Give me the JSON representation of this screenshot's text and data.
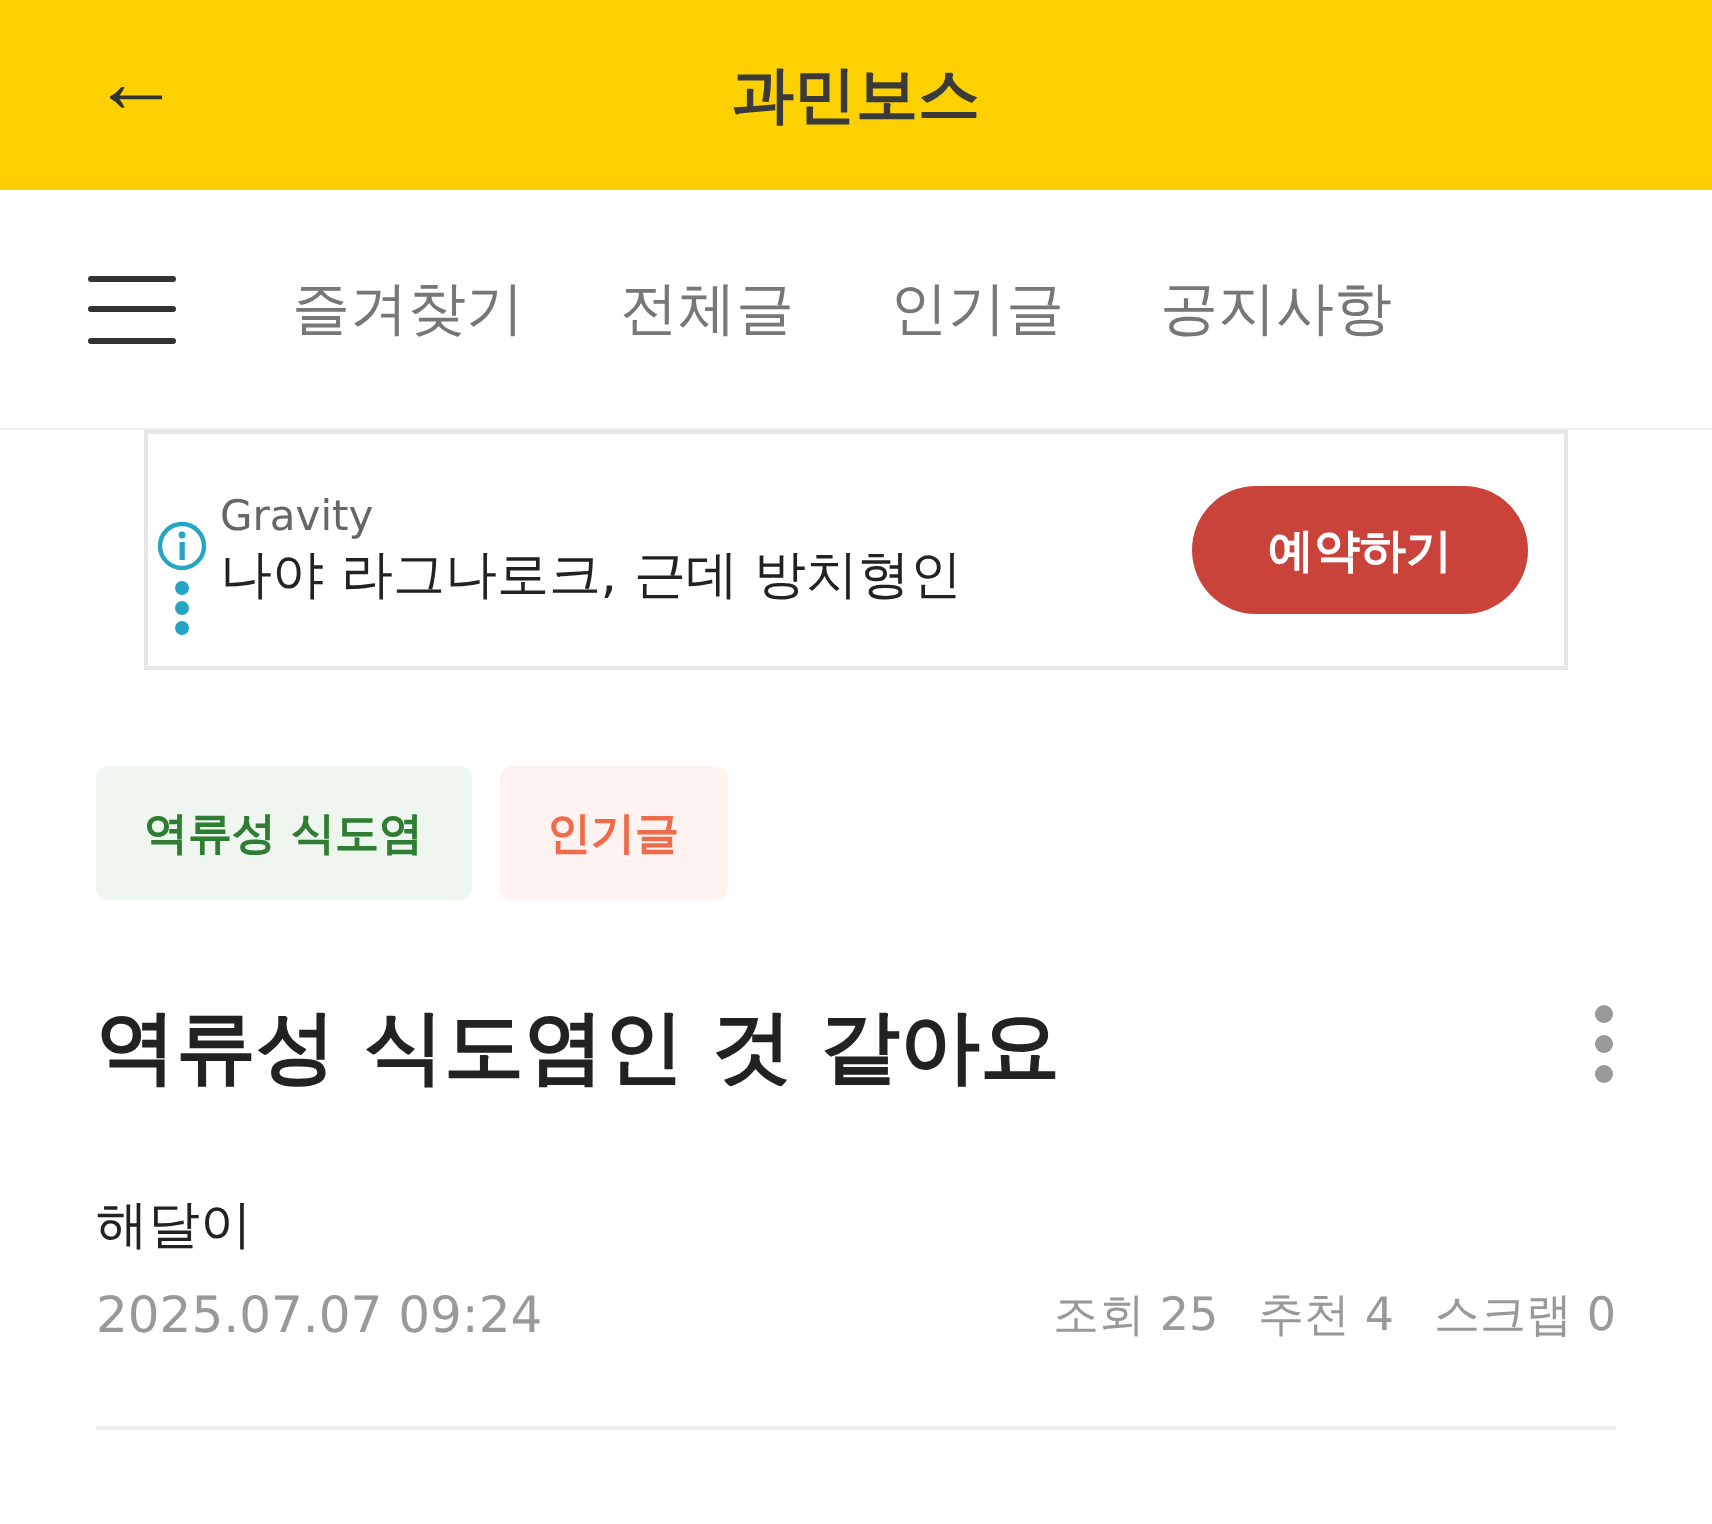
{
  "header": {
    "back": "←",
    "title": "과민보스"
  },
  "nav": {
    "tabs": [
      {
        "label": "즐겨찾기",
        "selected": false
      },
      {
        "label": "전체글",
        "selected": false
      },
      {
        "label": "인기글",
        "selected": false
      },
      {
        "label": "공지사항",
        "selected": false
      }
    ]
  },
  "ad": {
    "advertiser": "Gravity",
    "headline": "나야 라그나로크, 근데 방치형인",
    "button": "예약하기"
  },
  "post": {
    "tags": [
      {
        "label": "역류성 식도염",
        "color": "#2e7d32"
      },
      {
        "label": "인기글",
        "color": "#ef6c4a"
      }
    ],
    "title": "역류성 식도염인 것 같아요",
    "author": "해달이",
    "date": "2025.07.07 09:24",
    "stats": [
      "조회 25",
      "추천 4",
      "스크랩 0"
    ]
  }
}
